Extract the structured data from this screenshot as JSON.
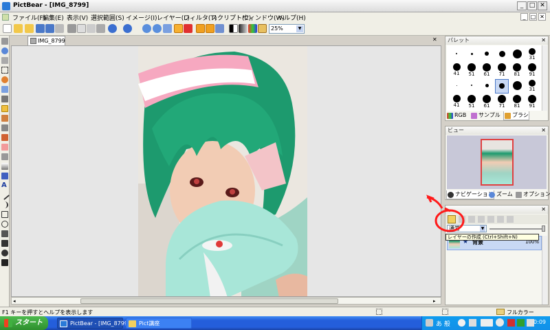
{
  "window": {
    "title": "PictBear - [IMG_8799]",
    "min": "_",
    "max": "□",
    "close": "✕"
  },
  "menu": [
    "ファイル(F)",
    "編集(E)",
    "表示(V)",
    "選択範囲(S)",
    "イメージ(I)",
    "レイヤー(L)",
    "フィルタ(T)",
    "スクリプト(C)",
    "ウィンドウ(W)",
    "ヘルプ(H)"
  ],
  "toolbar": {
    "zoom": "25%",
    "zoom_arrow": "▼"
  },
  "document": {
    "tab": "IMG_8799",
    "close": "✕"
  },
  "palette": {
    "title": "パレット",
    "close": "✕",
    "rows": [
      [
        {
          "d": 2,
          "n": ""
        },
        {
          "d": 3,
          "n": ""
        },
        {
          "d": 6,
          "n": ""
        },
        {
          "d": 9,
          "n": ""
        },
        {
          "d": 13,
          "n": ""
        },
        {
          "d": 10,
          "n": "31"
        }
      ],
      [
        {
          "d": 11,
          "n": "41"
        },
        {
          "d": 12,
          "n": "51"
        },
        {
          "d": 12,
          "n": "61"
        },
        {
          "d": 12,
          "n": "71"
        },
        {
          "d": 12,
          "n": "81"
        },
        {
          "d": 12,
          "n": "91"
        }
      ],
      [
        {
          "d": 1,
          "n": ""
        },
        {
          "d": 2,
          "n": ""
        },
        {
          "d": 5,
          "n": ""
        },
        {
          "d": 8,
          "n": ""
        },
        {
          "d": 13,
          "n": ""
        },
        {
          "d": 10,
          "n": "31"
        }
      ],
      [
        {
          "d": 11,
          "n": "41"
        },
        {
          "d": 12,
          "n": "51"
        },
        {
          "d": 12,
          "n": "61"
        },
        {
          "d": 12,
          "n": "71"
        },
        {
          "d": 12,
          "n": "81"
        },
        {
          "d": 12,
          "n": "91"
        }
      ]
    ],
    "tabs": [
      "RGB",
      "サンプル",
      "ブラシ"
    ]
  },
  "view": {
    "title": "ビュー",
    "close": "✕",
    "tabs": [
      "ナビゲーション",
      "ズーム",
      "オプション"
    ]
  },
  "layers": {
    "close": "✕",
    "blend_mode": "通常",
    "tooltip": "レイヤーの作成 (Ctrl+Shift+N)",
    "layer_name": "背景",
    "opacity": "100%",
    "star": "★"
  },
  "status": {
    "help": "F1 キーを押すとヘルプを表示します",
    "color_mode": "フルカラー"
  },
  "taskbar": {
    "start": "スタート",
    "tasks": [
      "PictBear - [IMG_8799]",
      "Pict講座"
    ],
    "ime": "あ 般",
    "clock": "0:09"
  },
  "colors": {
    "accent": "#245edb",
    "annotation": "#ff1a1a",
    "selection": "#c8d8f4"
  }
}
